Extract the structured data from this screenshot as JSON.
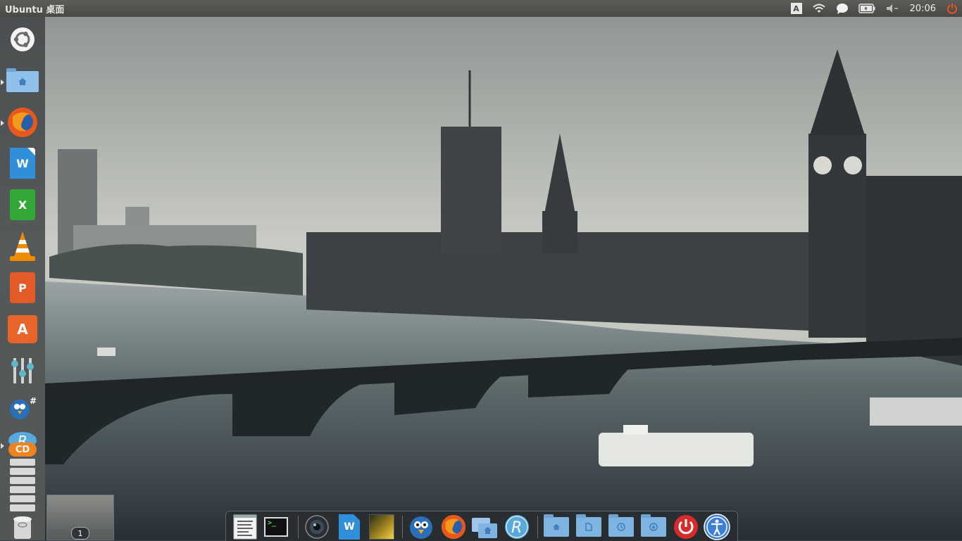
{
  "panel": {
    "title": "Ubuntu 桌面",
    "clock": "20:06",
    "keyboard_layout": "A",
    "indicators": [
      "keyboard-indicator-icon",
      "wifi-icon",
      "messaging-icon",
      "battery-icon",
      "volume-icon",
      "power-icon"
    ]
  },
  "launcher": {
    "items": [
      {
        "name": "ubuntu-dash",
        "icon": "ubuntu-logo-icon"
      },
      {
        "name": "files",
        "icon": "home-folder-icon",
        "running": true
      },
      {
        "name": "firefox",
        "icon": "firefox-icon",
        "running": true
      },
      {
        "name": "libreoffice-writer",
        "icon": "writer-document-icon"
      },
      {
        "name": "libreoffice-calc",
        "icon": "calc-spreadsheet-icon"
      },
      {
        "name": "vlc",
        "icon": "vlc-cone-icon"
      },
      {
        "name": "libreoffice-impress",
        "icon": "impress-presentation-icon"
      },
      {
        "name": "software-center",
        "icon": "software-center-bag-icon"
      },
      {
        "name": "mixer",
        "icon": "mixer-sliders-icon"
      },
      {
        "name": "hashtag-bird",
        "icon": "bird-hashtag-icon"
      },
      {
        "name": "r-studio",
        "icon": "r-logo-icon",
        "running": true
      },
      {
        "name": "cd-burner",
        "icon": "cd-icon"
      },
      {
        "name": "trash",
        "icon": "trash-icon"
      }
    ],
    "cd_label": "CD"
  },
  "workspace": {
    "number": "1"
  },
  "dock": {
    "items": [
      {
        "name": "text-editor",
        "icon": "text-editor-icon"
      },
      {
        "name": "terminal",
        "icon": "terminal-icon",
        "label": ">_"
      },
      {
        "name": "camera",
        "icon": "camera-lens-icon"
      },
      {
        "name": "writer",
        "icon": "writer-document-icon"
      },
      {
        "name": "image-viewer",
        "icon": "image-viewer-icon"
      },
      {
        "name": "bird-app",
        "icon": "bird-icon"
      },
      {
        "name": "firefox",
        "icon": "firefox-icon"
      },
      {
        "name": "file-manager",
        "icon": "folders-icon"
      },
      {
        "name": "r-studio",
        "icon": "r-logo-icon"
      },
      {
        "name": "home-folder",
        "icon": "home-folder-icon"
      },
      {
        "name": "documents-folder",
        "icon": "documents-folder-icon"
      },
      {
        "name": "recent-folder",
        "icon": "recent-folder-icon"
      },
      {
        "name": "downloads-folder",
        "icon": "downloads-folder-icon"
      },
      {
        "name": "shutdown",
        "icon": "power-icon"
      },
      {
        "name": "accessibility",
        "icon": "accessibility-icon"
      }
    ]
  },
  "colors": {
    "panel": "#4a4844",
    "launcher": "#3c4042",
    "accent_orange": "#e95420",
    "folder_blue": "#7fb3e0",
    "shutdown_red": "#d62b2b"
  }
}
